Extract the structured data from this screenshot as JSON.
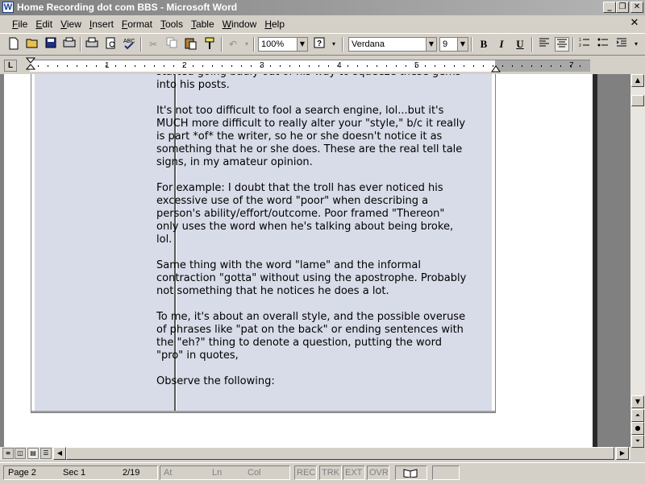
{
  "window": {
    "title": "Home Recording dot com BBS - Microsoft Word",
    "icon_label": "W",
    "buttons": {
      "minimize": "_",
      "restore": "❐",
      "close": "✕"
    }
  },
  "menubar": {
    "items": [
      "File",
      "Edit",
      "View",
      "Insert",
      "Format",
      "Tools",
      "Table",
      "Window",
      "Help"
    ],
    "doc_close": "✕"
  },
  "toolbar": {
    "zoom": "100%",
    "font_name": "Verdana",
    "font_size": "9",
    "bold": "B",
    "italic": "I",
    "underline": "U",
    "icons": {
      "new": "new-document-icon",
      "open": "open-folder-icon",
      "save": "save-icon",
      "print": "print-icon",
      "preview": "print-preview-icon",
      "spelling": "spelling-icon",
      "cut": "cut-icon",
      "copy": "copy-icon",
      "paste": "paste-icon",
      "format_painter": "format-painter-icon",
      "undo": "undo-icon",
      "help": "help-icon",
      "align_left": "align-left-icon",
      "center": "align-center-icon",
      "numbering": "numbering-icon",
      "bullets": "bullets-icon",
      "indent": "indent-icon"
    }
  },
  "ruler": {
    "tab_button": "L",
    "numbers": [
      "1",
      "2",
      "3",
      "4",
      "5",
      "7"
    ]
  },
  "document": {
    "paragraphs": [
      "started going badly out of his way to squeeze these gems into his posts.",
      "It's not too difficult to fool a search engine, lol...but it's MUCH more difficult to really alter your \"style,\" b/c it really is part *of* the writer, so he or she doesn't notice it as something that he or she does. These are the real tell tale signs, in my amateur opinion.",
      "For example: I doubt that the troll has ever noticed his excessive use of the word \"poor\" when describing a person's ability/effort/outcome. Poor framed \"Thereon\" only uses the word when he's talking about being broke, lol.",
      "Same thing with the word \"lame\" and the informal contraction \"gotta\" without using the apostrophe. Probably not something that he notices he does a lot.",
      "To me, it's about an overall style, and the possible overuse of phrases like \"pat on the back\" or ending sentences with the \"eh?\" thing to denote a question, putting the word \"pro\" in quotes,",
      "Observe the following:"
    ]
  },
  "statusbar": {
    "page": "Page 2",
    "section": "Sec 1",
    "pages": "2/19",
    "at": "At",
    "ln": "Ln",
    "col": "Col",
    "rec": "REC",
    "trk": "TRK",
    "ext": "EXT",
    "ovr": "OVR"
  }
}
